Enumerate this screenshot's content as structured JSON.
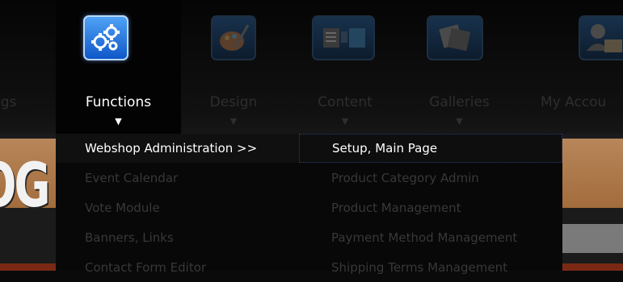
{
  "nav": {
    "items": [
      {
        "label": "ngs",
        "icon": "gears-icon",
        "active": false
      },
      {
        "label": "Functions",
        "icon": "gears-icon",
        "active": true
      },
      {
        "label": "Design",
        "icon": "palette-icon",
        "active": false
      },
      {
        "label": "Content",
        "icon": "content-blocks-icon",
        "active": false
      },
      {
        "label": "Galleries",
        "icon": "photos-icon",
        "active": false
      },
      {
        "label": "My Accou",
        "icon": "user-icon",
        "active": false
      }
    ],
    "arrow": "▼"
  },
  "background": {
    "logo_text": "OG"
  },
  "functions_menu": {
    "items": [
      {
        "label": "Webshop Administration >>",
        "active": true
      },
      {
        "label": "Event Calendar",
        "active": false
      },
      {
        "label": "Vote Module",
        "active": false
      },
      {
        "label": "Banners, Links",
        "active": false
      },
      {
        "label": "Contact Form Editor",
        "active": false
      }
    ]
  },
  "webshop_submenu": {
    "items": [
      {
        "label": "Setup, Main Page",
        "active": true
      },
      {
        "label": "Product Category Admin",
        "active": false
      },
      {
        "label": "Product Management",
        "active": false
      },
      {
        "label": "Payment Method Management",
        "active": false
      },
      {
        "label": "Shipping Terms Management",
        "active": false
      }
    ]
  },
  "colors": {
    "accent_blue": "#1f6fe0",
    "menu_bg": "#080808",
    "orange_band": "#a36c3c"
  }
}
